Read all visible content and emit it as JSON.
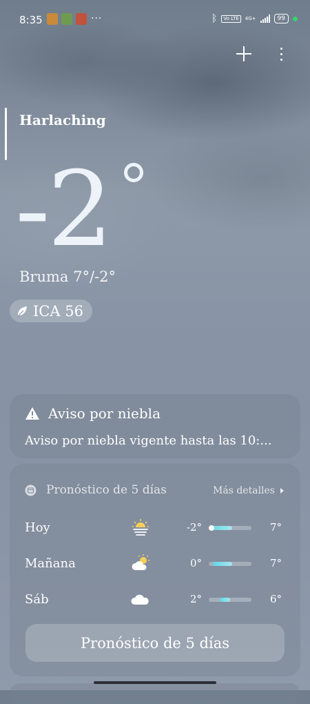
{
  "status_bar": {
    "time": "8:35",
    "more": "···",
    "network": "4G+",
    "volte": "Vo LTE",
    "battery": "99"
  },
  "location": {
    "city": "Harlaching"
  },
  "current": {
    "temperature": "-2",
    "condition": "Bruma  7°/-2°",
    "aqi": "ICA 56"
  },
  "alert": {
    "title": "Aviso por niebla",
    "body": "Aviso por niebla vigente hasta las 10:..."
  },
  "forecast": {
    "title": "Pronóstico de 5 días",
    "more_details": "Más detalles",
    "days": [
      {
        "day": "Hoy",
        "icon": "sun-fog-icon",
        "low": "-2°",
        "high": "7°",
        "range_start": 0.0,
        "range_end": 0.55,
        "current": 0.0
      },
      {
        "day": "Mañana",
        "icon": "partly-cloudy-icon",
        "low": "0°",
        "high": "7°",
        "range_start": 0.1,
        "range_end": 0.55,
        "current": null
      },
      {
        "day": "Sáb",
        "icon": "cloud-icon",
        "low": "2°",
        "high": "6°",
        "range_start": 0.25,
        "range_end": 0.5,
        "current": null
      }
    ],
    "button_label": "Pronóstico de 5 días"
  },
  "colors": {
    "range_fill": "#5fd6e6",
    "status_dot": "#37d36a"
  }
}
